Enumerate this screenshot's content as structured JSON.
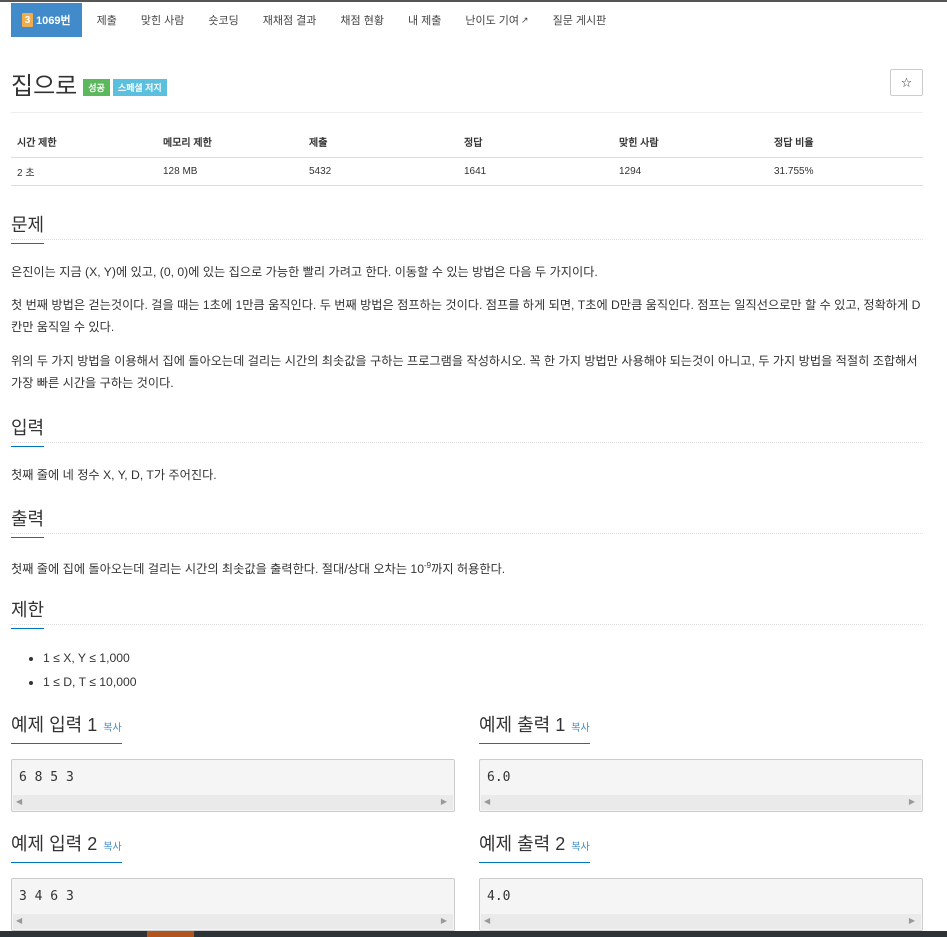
{
  "nav": {
    "tier": "3",
    "problem_number": "1069번",
    "items": [
      "제출",
      "맞힌 사람",
      "숏코딩",
      "재채점 결과",
      "채점 현황",
      "내 제출",
      "난이도 기여",
      "질문 게시판"
    ]
  },
  "problem": {
    "title": "집으로",
    "badges": [
      "성공",
      "스페셜 저지"
    ],
    "star": "☆"
  },
  "info_table": {
    "headers": [
      "시간 제한",
      "메모리 제한",
      "제출",
      "정답",
      "맞힌 사람",
      "정답 비율"
    ],
    "values": [
      "2 초",
      "128 MB",
      "5432",
      "1641",
      "1294",
      "31.755%"
    ]
  },
  "sections": {
    "description": "문제",
    "input": "입력",
    "output": "출력",
    "limits": "제한"
  },
  "description": {
    "p1": "은진이는 지금 (X, Y)에 있고, (0, 0)에 있는 집으로 가능한 빨리 가려고 한다. 이동할 수 있는 방법은 다음 두 가지이다.",
    "p2": "첫 번째 방법은 걷는것이다. 걸을 때는 1초에 1만큼 움직인다. 두 번째 방법은 점프하는 것이다. 점프를 하게 되면, T초에 D만큼 움직인다. 점프는 일직선으로만 할 수 있고, 정확하게 D칸만 움직일 수 있다.",
    "p3": "위의 두 가지 방법을 이용해서 집에 돌아오는데 걸리는 시간의 최솟값을 구하는 프로그램을 작성하시오. 꼭 한 가지 방법만 사용해야 되는것이 아니고, 두 가지 방법을 적절히 조합해서 가장 빠른 시간을 구하는 것이다."
  },
  "input_text": "첫째 줄에 네 정수 X, Y, D, T가 주어진다.",
  "output_text": {
    "before": "첫째 줄에 집에 돌아오는데 걸리는 시간의 최솟값을 출력한다. 절대/상대 오차는 10",
    "sup": "-9",
    "after": "까지 허용한다."
  },
  "limits": [
    "1 ≤ X, Y ≤ 1,000",
    "1 ≤ D, T ≤ 10,000"
  ],
  "examples": {
    "copy_label": "복사",
    "input1_title": "예제 입력 1",
    "output1_title": "예제 출력 1",
    "input2_title": "예제 입력 2",
    "output2_title": "예제 출력 2",
    "input1": "6 8 5 3",
    "output1": "6.0",
    "input2": "3 4 6 3",
    "output2": "4.0"
  },
  "colors": {
    "nav_active": "#428bca",
    "tier_badge": "#f0ad4e",
    "success_badge": "#5cb85c",
    "special_badge": "#5bc0de",
    "section_underline": "#0076c0"
  }
}
